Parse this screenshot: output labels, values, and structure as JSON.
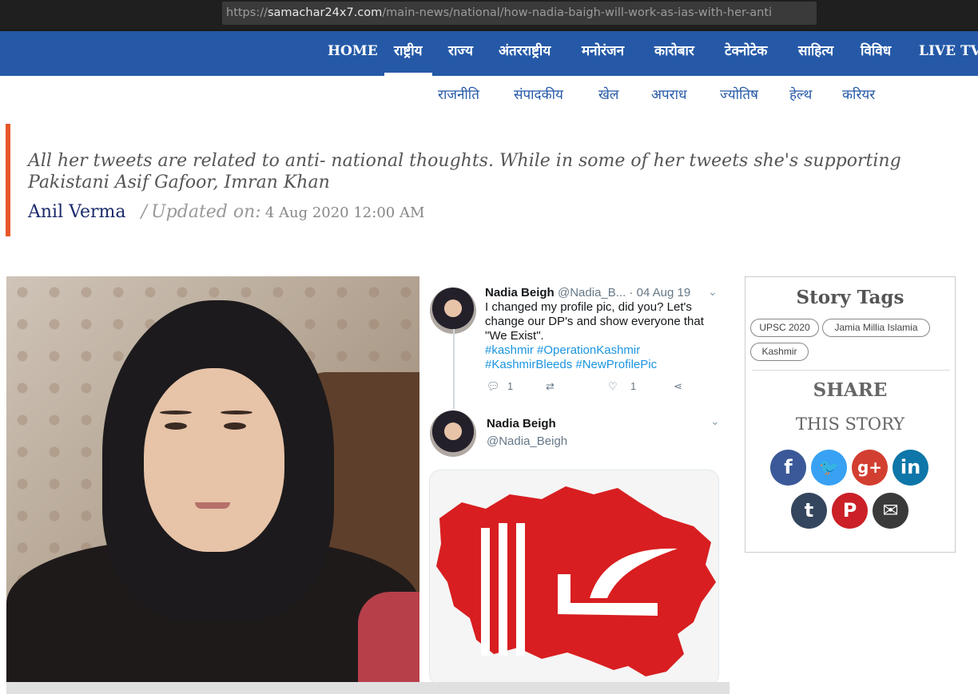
{
  "browser": {
    "url_prefix": "https://",
    "url_host": "samachar24x7.com",
    "url_path": "/main-news/national/how-nadia-baigh-will-work-as-ias-with-her-anti"
  },
  "main_nav": [
    {
      "label": "HOME"
    },
    {
      "label": "राष्ट्रीय"
    },
    {
      "label": "राज्य"
    },
    {
      "label": "अंतरराष्ट्रीय"
    },
    {
      "label": "मनोरंजन"
    },
    {
      "label": "कारोबार"
    },
    {
      "label": "टेक्नोटेक"
    },
    {
      "label": "साहित्य"
    },
    {
      "label": "विविध"
    },
    {
      "label": "LIVE TV"
    }
  ],
  "sub_nav": [
    {
      "label": "राजनीति"
    },
    {
      "label": "संपादकीय"
    },
    {
      "label": "खेल"
    },
    {
      "label": "अपराध"
    },
    {
      "label": "ज्योतिष"
    },
    {
      "label": "हेल्थ"
    },
    {
      "label": "करियर"
    }
  ],
  "article": {
    "summary": "All her tweets are related to anti- national thoughts. While in some of her tweets she's supporting Pakistani Asif Gafoor, Imran Khan",
    "author": "Anil Verma",
    "separator": "/",
    "updated_label": "Updated on:",
    "date": "4 Aug 2020 12:00 AM"
  },
  "tweet": {
    "first": {
      "name": "Nadia Beigh",
      "handle_meta": "@Nadia_B... · 04 Aug 19",
      "text": "I changed my profile pic, did you? Let's change our DP's and show everyone that \"We Exist\".",
      "hashtags": "#kashmir #OperationKashmir #KashmirBleeds #NewProfilePic",
      "reply_count": "1",
      "like_count": "1"
    },
    "second": {
      "name": "Nadia Beigh",
      "handle": "@Nadia_Beigh"
    }
  },
  "sidebar": {
    "tags_title": "Story Tags",
    "tags": [
      {
        "label": "UPSC 2020"
      },
      {
        "label": "Jamia Millia Islamia"
      },
      {
        "label": "Kashmir"
      }
    ],
    "share_title": "SHARE",
    "share_subtitle": "THIS STORY",
    "social": [
      {
        "glyph": "f",
        "icon": "facebook-icon",
        "color": "#3b5998"
      },
      {
        "glyph": "🐦",
        "icon": "twitter-icon",
        "color": "#38a1f3"
      },
      {
        "glyph": "g+",
        "icon": "google-plus-icon",
        "color": "#d23f31"
      },
      {
        "glyph": "in",
        "icon": "linkedin-icon",
        "color": "#0e76a8"
      },
      {
        "glyph": "t",
        "icon": "tumblr-icon",
        "color": "#34465d"
      },
      {
        "glyph": "P",
        "icon": "pinterest-icon",
        "color": "#cb2027"
      },
      {
        "glyph": "✉",
        "icon": "email-icon",
        "color": "#3a3a3a"
      }
    ]
  },
  "colors": {
    "nav_bg": "#2559a7",
    "accent_bar": "#e8562a",
    "author": "#1b2a6b",
    "hashtag": "#1b95e0"
  }
}
